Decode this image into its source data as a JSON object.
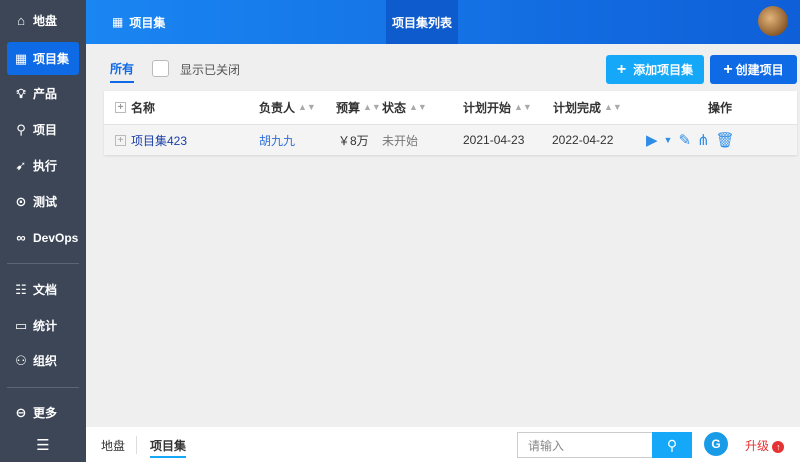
{
  "sidebar": {
    "items": [
      {
        "label": "地盘",
        "icon": "home-icon"
      },
      {
        "label": "项目集",
        "icon": "grid-icon"
      },
      {
        "label": "产品",
        "icon": "lightbulb-icon"
      },
      {
        "label": "项目",
        "icon": "rocket-icon"
      },
      {
        "label": "执行",
        "icon": "run-icon"
      },
      {
        "label": "测试",
        "icon": "search-bug-icon"
      },
      {
        "label": "DevOps",
        "icon": "infinity-icon"
      },
      {
        "label": "文档",
        "icon": "doc-icon"
      },
      {
        "label": "统计",
        "icon": "chart-icon"
      },
      {
        "label": "组织",
        "icon": "users-icon"
      },
      {
        "label": "更多",
        "icon": "more-icon"
      }
    ]
  },
  "header": {
    "title": "项目集",
    "tab": "项目集列表"
  },
  "filter": {
    "all": "所有",
    "show_closed": "显示已关闭"
  },
  "toolbar": {
    "add_label": "添加项目集",
    "create_label": "创建项目"
  },
  "table": {
    "headers": [
      "名称",
      "负责人",
      "预算",
      "状态",
      "计划开始",
      "计划完成",
      "操作"
    ],
    "rows": [
      {
        "name": "项目集423",
        "owner": "胡九九",
        "budget": "￥8万",
        "status": "未开始",
        "begin": "2021-04-23",
        "end": "2022-04-22"
      }
    ]
  },
  "footer": {
    "crumbs": [
      "地盘",
      "项目集"
    ],
    "search_placeholder": "请输入",
    "upgrade": "升级"
  },
  "colors": {
    "primary": "#0f6ae6",
    "secondary": "#16a8f8",
    "sidebar": "#3c4657"
  }
}
